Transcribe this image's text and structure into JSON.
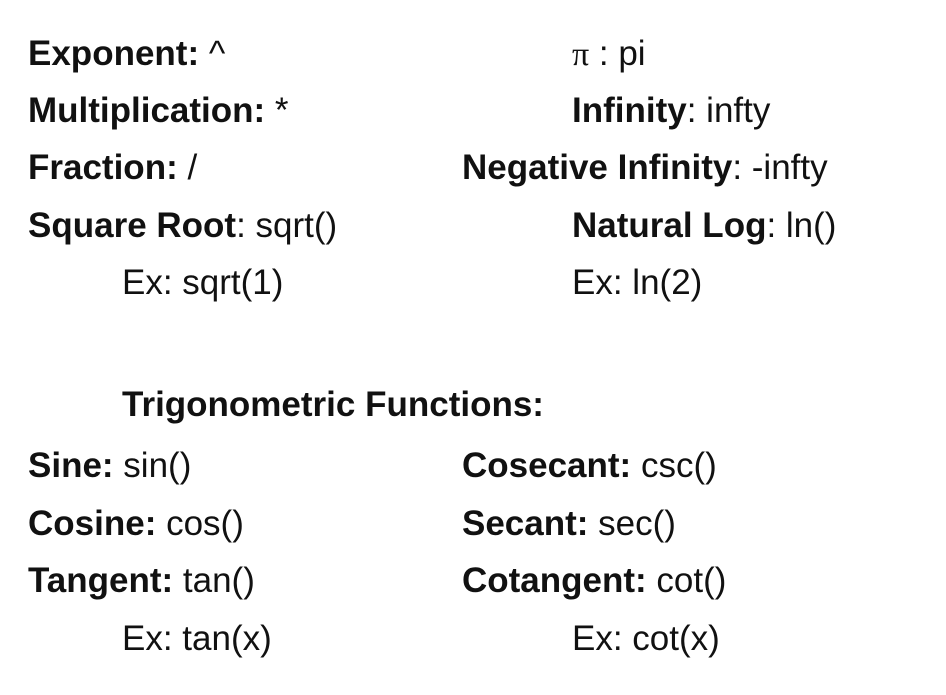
{
  "reference": {
    "left": [
      {
        "label": "Exponent:",
        "value": " ^"
      },
      {
        "label": "Multiplication:",
        "value": " *"
      },
      {
        "label": "Fraction:",
        "value": " /"
      },
      {
        "label": "Square Root",
        "value": ": sqrt()"
      },
      {
        "example": "Ex: sqrt(1)"
      }
    ],
    "right": [
      {
        "symbol": "π",
        "value": " : pi"
      },
      {
        "label": "Infinity",
        "value": ": infty"
      },
      {
        "label": "Negative Infinity",
        "value": ": -infty"
      },
      {
        "label": "Natural Log",
        "value": ": ln()"
      },
      {
        "example": "Ex: ln(2)"
      }
    ]
  },
  "trig": {
    "heading": "Trigonometric Functions:",
    "left": [
      {
        "label": "Sine:",
        "value": " sin()"
      },
      {
        "label": "Cosine:",
        "value": " cos()"
      },
      {
        "label": "Tangent:",
        "value": " tan()"
      },
      {
        "example": "Ex: tan(x)"
      }
    ],
    "right": [
      {
        "label": "Cosecant:",
        "value": " csc()"
      },
      {
        "label": "Secant:",
        "value": " sec()"
      },
      {
        "label": "Cotangent:",
        "value": " cot()"
      },
      {
        "example": "Ex: cot(x)"
      }
    ]
  }
}
